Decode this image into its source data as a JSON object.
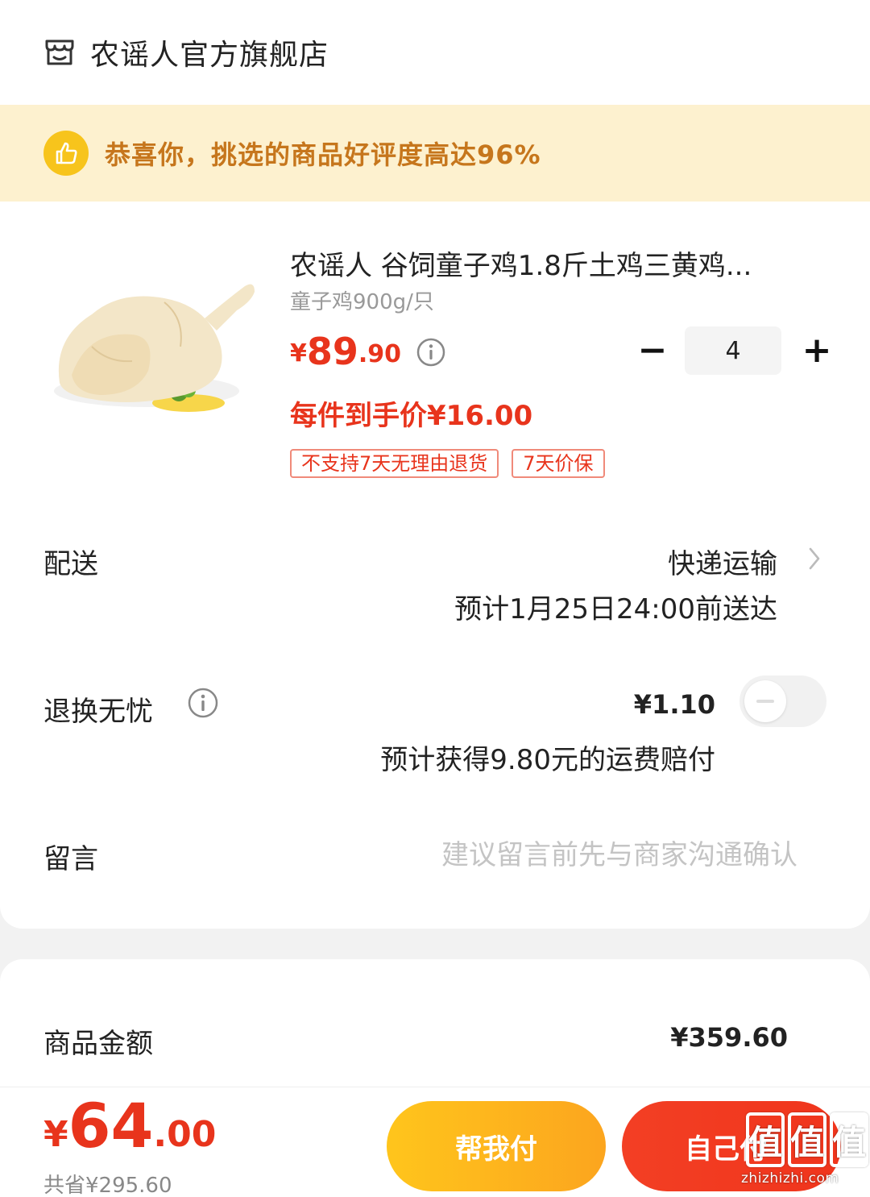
{
  "store": {
    "name": "农谣人官方旗舰店",
    "icon": "store-icon"
  },
  "banner": {
    "text": "恭喜你，挑选的商品好评度高达96%",
    "icon": "thumbs-up-icon",
    "color": "#c6761c"
  },
  "product": {
    "title": "农谣人 谷饲童子鸡1.8斤土鸡三黄鸡...",
    "spec": "童子鸡900g/只",
    "price_symbol": "¥",
    "price_int": "89",
    "price_dec": ".90",
    "quantity": "4",
    "minus_label": "−",
    "plus_label": "+",
    "unit_price_text": "每件到手价¥16.00",
    "tags": [
      "不支持7天无理由退货",
      "7天价保"
    ],
    "image_icon": "whole-chicken-image"
  },
  "delivery": {
    "label": "配送",
    "method": "快递运输",
    "eta": "预计1月25日24:00前送达"
  },
  "returns": {
    "label": "退换无忧",
    "price": "¥1.10",
    "compensation": "预计获得9.80元的运费赔付",
    "toggle_on": false
  },
  "remark": {
    "label": "留言",
    "placeholder": "建议留言前先与商家沟通确认"
  },
  "summary": {
    "amount_label": "商品金额",
    "amount_value": "¥359.60"
  },
  "footer": {
    "total_symbol": "¥",
    "total_int": "64",
    "total_dec": ".00",
    "saved": "共省¥295.60",
    "help_pay_label": "帮我付",
    "self_pay_label": "自己付"
  },
  "watermark": {
    "chars": [
      "值",
      "值",
      "值"
    ],
    "url": "zhizhizhi.com"
  },
  "colors": {
    "accent_red": "#e8341c",
    "accent_yellow": "#fca51e",
    "banner_bg": "#fdf1cf"
  }
}
